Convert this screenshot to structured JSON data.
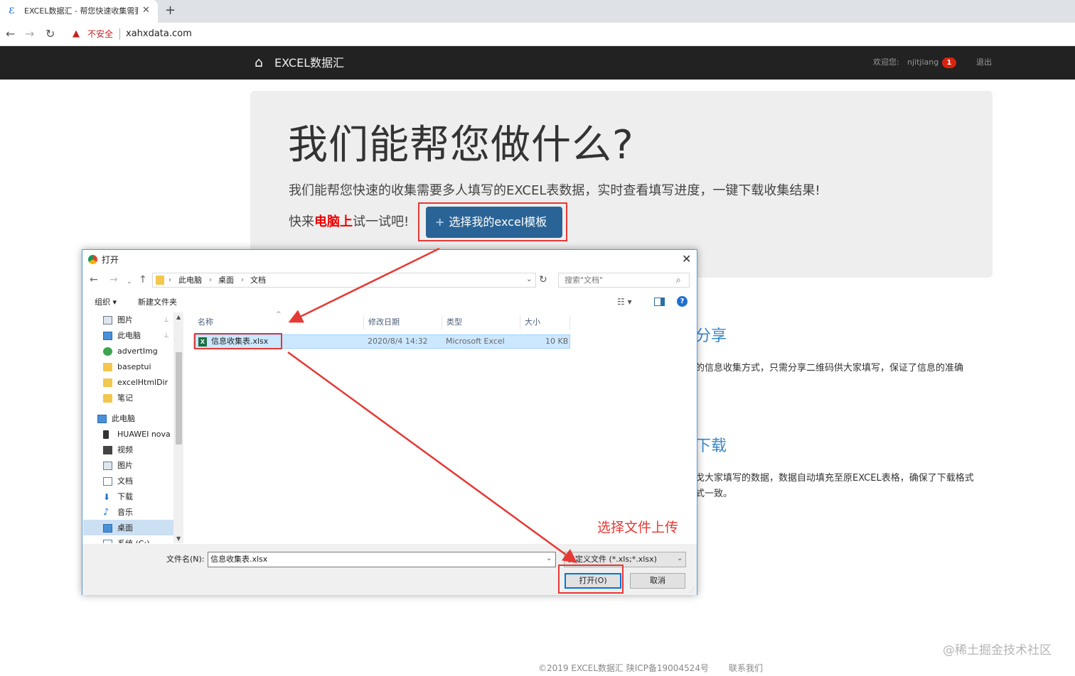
{
  "browser": {
    "tab_title": "EXCEL数据汇 - 帮您快速收集需要",
    "tab_favicon": "ℰ",
    "new_tab": "+",
    "close": "✕",
    "back": "←",
    "forward": "→",
    "reload": "↻",
    "warning_icon": "▲",
    "security_label": "不安全",
    "url": "xahxdata.com"
  },
  "navbar": {
    "brand": "EXCEL数据汇",
    "home_icon": "⌂",
    "welcome": "欢迎您:",
    "username": "njitjiang",
    "badge": "1",
    "logout": "退出"
  },
  "hero": {
    "headline": "我们能帮您做什么?",
    "lead": "我们能帮您快速的收集需要多人填写的EXCEL表数据，实时查看填写进度，一键下载收集结果!",
    "try_prefix": "快来",
    "try_highlight": "电脑上",
    "try_suffix": "试一试吧!",
    "button_plus": "+",
    "button_label": "选择我的excel模板"
  },
  "features": {
    "share_title": "分享",
    "share_desc": "的信息收集方式，只需分享二维码供大家填写，保证了信息的准确",
    "download_title": "下载",
    "download_desc1": "戈大家填写的数据，数据自动填充至原EXCEL表格，确保了下载格式",
    "download_desc2": "式一致。"
  },
  "footer": {
    "copyright": "©2019 EXCEL数据汇  陕ICP备19004524号",
    "contact": "联系我们",
    "watermark": "@稀土掘金技术社区"
  },
  "dialog": {
    "title": "打开",
    "close": "✕",
    "breadcrumb": [
      "此电脑",
      "桌面",
      "文档"
    ],
    "search_placeholder": "搜索\"文档\"",
    "search_icon": "⌕",
    "organize": "组织 ▾",
    "new_folder": "新建文件夹",
    "view_icon": "☷ ▾",
    "help": "?",
    "nav_items": [
      {
        "label": "图片",
        "icon": "pic",
        "pinned": true
      },
      {
        "label": "此电脑",
        "icon": "pc",
        "pinned": true
      },
      {
        "label": "advertImg",
        "icon": "green",
        "pinned": false
      },
      {
        "label": "baseptui",
        "icon": "folder",
        "pinned": false
      },
      {
        "label": "excelHtmlDir",
        "icon": "folder",
        "pinned": false
      },
      {
        "label": "笔记",
        "icon": "folder",
        "pinned": false
      },
      {
        "label": "此电脑",
        "icon": "pc",
        "pinned": false
      },
      {
        "label": "HUAWEI nova",
        "icon": "phone",
        "pinned": false
      },
      {
        "label": "视频",
        "icon": "vid",
        "pinned": false
      },
      {
        "label": "图片",
        "icon": "pic",
        "pinned": false
      },
      {
        "label": "文档",
        "icon": "doc",
        "pinned": false
      },
      {
        "label": "下载",
        "icon": "download",
        "pinned": false
      },
      {
        "label": "音乐",
        "icon": "music",
        "pinned": false
      },
      {
        "label": "桌面",
        "icon": "pc",
        "pinned": false
      },
      {
        "label": "系统 (C:)",
        "icon": "doc",
        "pinned": false
      }
    ],
    "pin_icon": "📌",
    "columns": [
      "名称",
      "修改日期",
      "类型",
      "大小"
    ],
    "files": [
      {
        "name": "信息收集表.xlsx",
        "modified": "2020/8/4 14:32",
        "type": "Microsoft Excel",
        "size": "10 KB",
        "icon": "X"
      }
    ],
    "filename_label": "文件名(N):",
    "filename_value": "信息收集表.xlsx",
    "filetype": "自定义文件 (*.xls;*.xlsx)",
    "open_button": "打开(O)",
    "cancel_button": "取消"
  },
  "annotation": {
    "label": "选择文件上传",
    "color": "#e53935"
  }
}
